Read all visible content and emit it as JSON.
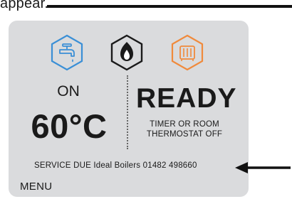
{
  "caption": "appear.",
  "panel": {
    "hot_water_status": "ON",
    "temperature": "60°C",
    "boiler_status": "READY",
    "boiler_message_line1": "TIMER OR ROOM",
    "boiler_message_line2": "THERMOSTAT OFF",
    "service_message": "SERVICE DUE Ideal Boilers 01482 498660",
    "menu_label": "MENU",
    "icons": [
      "tap-icon",
      "flame-icon",
      "radiator-icon"
    ]
  },
  "colors": {
    "screen_bg": "#dadbdd",
    "tap_icon": "#3a8fd6",
    "flame_icon": "#1a1a1a",
    "radiator_icon": "#f08a3c",
    "arrow": "#111111"
  }
}
